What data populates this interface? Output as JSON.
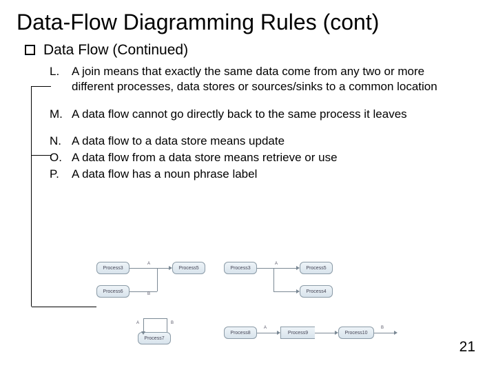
{
  "title": "Data-Flow Diagramming Rules (cont)",
  "subhead": "Data Flow (Continued)",
  "items": {
    "L": {
      "letter": "L.",
      "text": "A join means that exactly the same data come from any two or more different processes, data stores or sources/sinks to a common location"
    },
    "M": {
      "letter": "M.",
      "text": "A data flow cannot go directly back to the same process it leaves"
    },
    "N": {
      "letter": "N.",
      "text": "A data flow to a data store means update"
    },
    "O": {
      "letter": "O.",
      "text": "A data flow from a data store means retrieve or use"
    },
    "P": {
      "letter": "P.",
      "text": "A data flow has a noun phrase label"
    }
  },
  "diagram": {
    "g1": {
      "p1": "Process3",
      "p2": "Process6",
      "p3": "Process5",
      "la": "A",
      "lb": "B"
    },
    "g2": {
      "p1": "Process3",
      "p2": "Process4",
      "p3": "Process5",
      "la": "A"
    },
    "g3": {
      "p1": "Process7",
      "la": "A",
      "lb": "B"
    },
    "g4": {
      "p1": "Process8",
      "p2": "Process9",
      "p3": "Process10",
      "la": "A",
      "lb": "B"
    }
  },
  "pagenum": "21"
}
